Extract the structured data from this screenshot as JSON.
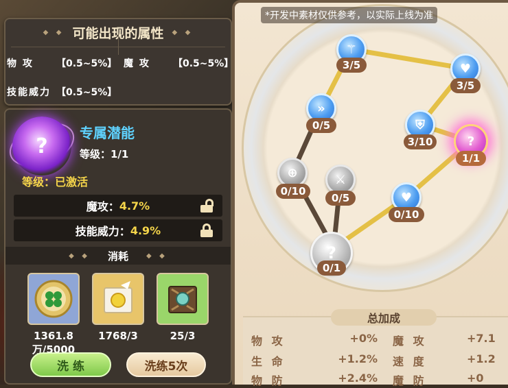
{
  "possible_attributes": {
    "title": "可能出现的属性",
    "items": [
      {
        "label": "物 攻",
        "range": "【0.5~5%】"
      },
      {
        "label": "魔 攻",
        "range": "【0.5~5%】"
      },
      {
        "label": "技能威力",
        "range": "【0.5~5%】"
      }
    ]
  },
  "exclusive": {
    "icon": "question-potential-icon",
    "title": "专属潜能",
    "level": "等级：1/1",
    "status": "等级：已激活",
    "stats": [
      {
        "label": "魔攻：",
        "value": "4.7%",
        "lock_state": "unlocked"
      },
      {
        "label": "技能威力：",
        "value": "4.9%",
        "lock_state": "locked"
      }
    ]
  },
  "cost": {
    "title": "消耗",
    "items": [
      {
        "icon": "clover-coin-icon",
        "count": "1361.8万/5000"
      },
      {
        "icon": "golden-book-icon",
        "count": "1768/3"
      },
      {
        "icon": "ancient-tome-icon",
        "count": "25/3"
      }
    ]
  },
  "buttons": {
    "refine": "洗 练",
    "refine5": "洗练5次"
  },
  "notice": "*开发中素材仅供参考，以实际上线为准",
  "nodes": [
    {
      "icon": "staff-icon",
      "level": "3/5",
      "color": "blue"
    },
    {
      "icon": "heart-icon",
      "level": "3/5",
      "color": "blue"
    },
    {
      "icon": "chevron-icon",
      "level": "0/5",
      "color": "blue"
    },
    {
      "icon": "shield-icon",
      "level": "3/10",
      "color": "blue"
    },
    {
      "icon": "potential-icon",
      "level": "1/1",
      "color": "pink"
    },
    {
      "icon": "crosshair-icon",
      "level": "0/10",
      "color": "gray"
    },
    {
      "icon": "sword-icon",
      "level": "0/5",
      "color": "gray"
    },
    {
      "icon": "heart-icon",
      "level": "0/10",
      "color": "blue"
    },
    {
      "icon": "question-icon",
      "level": "0/1",
      "color": "gray"
    }
  ],
  "total_bonus": {
    "title": "总加成",
    "rows": [
      {
        "l1": "物 攻",
        "v1": "+0%",
        "l2": "魔 攻",
        "v2": "+7.1"
      },
      {
        "l1": "生 命",
        "v1": "+1.2%",
        "l2": "速 度",
        "v2": "+1.2"
      },
      {
        "l1": "物 防",
        "v1": "+2.4%",
        "l2": "魔 防",
        "v2": "+0"
      }
    ]
  },
  "colors": {
    "accent_yellow": "#f5d54a",
    "accent_blue": "#5fd2ff",
    "node_blue": "#4c9cf0",
    "node_pink": "#e25bd0",
    "button_green": "#7fc94a"
  }
}
